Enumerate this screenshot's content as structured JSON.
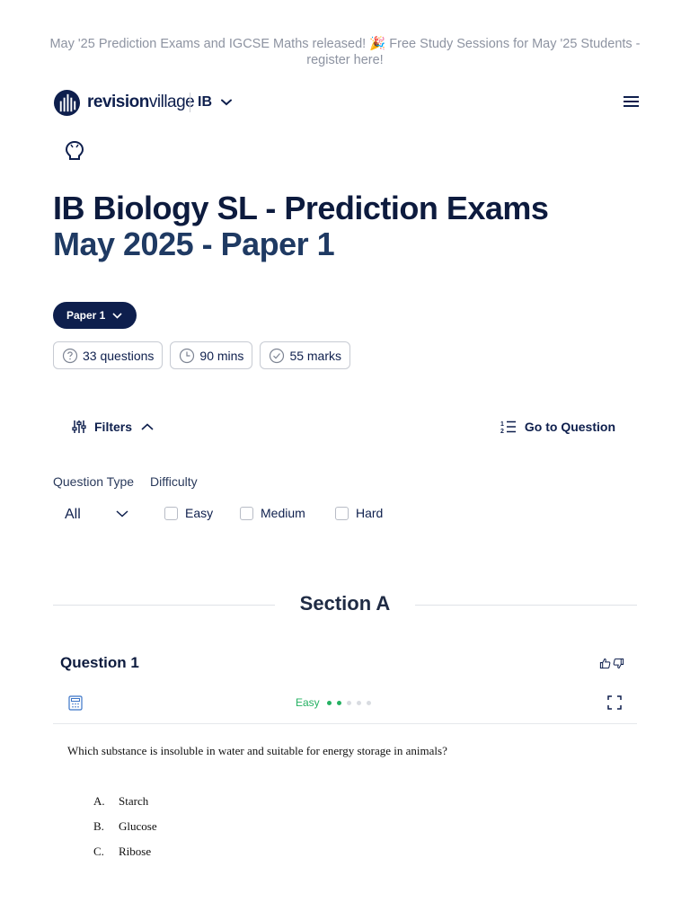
{
  "banner": {
    "text": "May '25 Prediction Exams and IGCSE Maths released! 🎉 Free Study Sessions for May '25 Students - register here!"
  },
  "nav": {
    "logo_bold": "revision",
    "logo_light": "village",
    "curriculum": "IB"
  },
  "page": {
    "title_line1": "IB Biology SL - Prediction Exams",
    "title_line2": "May 2025 - Paper 1"
  },
  "paper_select": {
    "label": "Paper 1"
  },
  "stats": {
    "questions": "33 questions",
    "duration": "90 mins",
    "marks": "55 marks"
  },
  "toolbar": {
    "filters_label": "Filters",
    "goto_label": "Go to Question"
  },
  "filters": {
    "question_type_label": "Question Type",
    "difficulty_label": "Difficulty",
    "question_type_value": "All",
    "difficulty_options": [
      "Easy",
      "Medium",
      "Hard"
    ]
  },
  "section": {
    "title": "Section A"
  },
  "question": {
    "heading": "Question 1",
    "difficulty": "Easy",
    "difficulty_level": 2,
    "difficulty_max": 5,
    "text": "Which substance is insoluble in water and suitable for energy storage in animals?",
    "options": [
      {
        "letter": "A.",
        "text": "Starch"
      },
      {
        "letter": "B.",
        "text": "Glucose"
      },
      {
        "letter": "C.",
        "text": "Ribose"
      }
    ]
  },
  "colors": {
    "navy": "#0e1f4d",
    "title_secondary": "#1f3a63",
    "easy_green": "#25b162",
    "banner_grey": "#8d93a1"
  }
}
